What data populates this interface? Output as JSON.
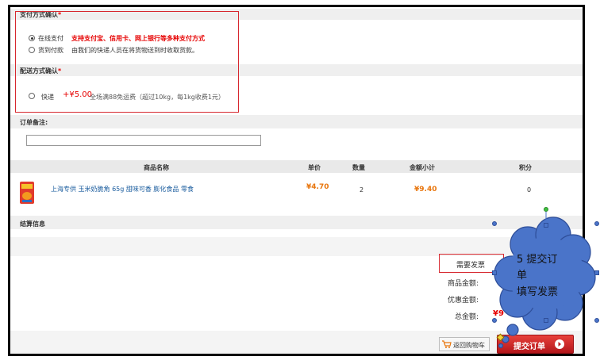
{
  "payment": {
    "title": "支付方式确认",
    "required_mark": "*",
    "options": [
      {
        "label": "在线支付",
        "desc": "支持支付宝、信用卡、网上银行等多种支付方式",
        "selected": true
      },
      {
        "label": "货到付款",
        "desc": "由我们的快递人员在将货物送到时收取货款。",
        "selected": false
      }
    ]
  },
  "shipping": {
    "title": "配送方式确认",
    "required_mark": "*",
    "option_label": "快递",
    "price": "+¥5.00",
    "desc": "全场满88免运费（超过10kg，每1kg收费1元）"
  },
  "remark": {
    "label": "订单备注:",
    "value": ""
  },
  "table": {
    "headers": [
      "商品名称",
      "单价",
      "数量",
      "金额小计",
      "积分"
    ],
    "rows": [
      {
        "name": "上海专供 玉米奶脆角 65g 甜味可香 膨化食品 零食",
        "price": "¥4.70",
        "qty": "2",
        "subtotal": "¥9.40",
        "points": "0"
      }
    ]
  },
  "settlement": {
    "title": "结算信息",
    "invoice_label": "需要发票",
    "goods_amount_label": "商品金额:",
    "discount_label": "优惠金额:",
    "total_label": "总金额:",
    "total_value_partial": "¥9"
  },
  "buttons": {
    "back_cart": "返回购物车",
    "submit": "提交订单"
  },
  "callout": {
    "line1": "5  提交订",
    "line2": "单",
    "line3": "填写发票"
  },
  "colors": {
    "accent_red": "#d7282f",
    "price_orange": "#e8750c",
    "link_blue": "#1a5c9e",
    "callout_blue": "#4a74c9"
  }
}
